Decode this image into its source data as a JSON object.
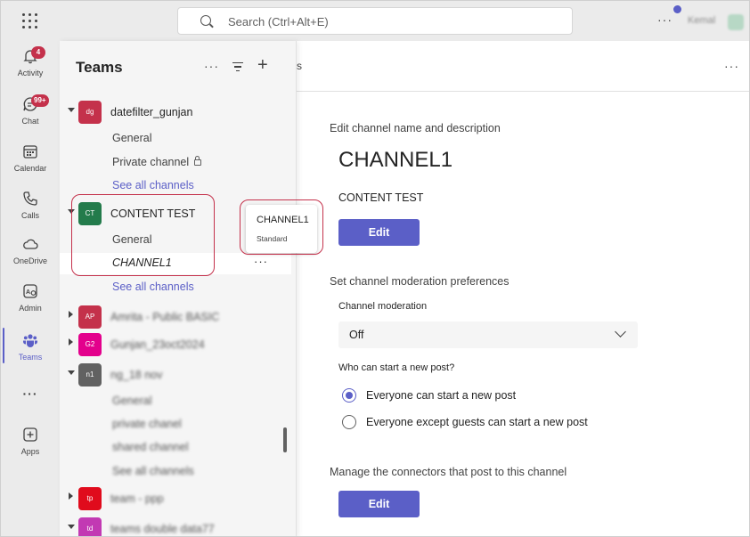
{
  "topbar": {
    "search_placeholder": "Search (Ctrl+Alt+E)",
    "more": "···",
    "user_name": "Kemal"
  },
  "rail": [
    {
      "label": "Activity",
      "icon": "bell-icon",
      "badge": "4"
    },
    {
      "label": "Chat",
      "icon": "chat-icon",
      "badge": "99+"
    },
    {
      "label": "Calendar",
      "icon": "calendar-icon"
    },
    {
      "label": "Calls",
      "icon": "phone-icon"
    },
    {
      "label": "OneDrive",
      "icon": "cloud-icon"
    },
    {
      "label": "Admin",
      "icon": "admin-icon"
    },
    {
      "label": "Teams",
      "icon": "teams-icon",
      "active": true
    },
    {
      "label": "···",
      "icon": "more-icon"
    },
    {
      "label": "Apps",
      "icon": "apps-plus-icon"
    }
  ],
  "teams_panel": {
    "title": "Teams",
    "more": "···",
    "teams": [
      {
        "initials": "dg",
        "name": "datefilter_gunjan",
        "color": "#c4314b",
        "expanded": true,
        "channels": [
          "General",
          "Private channel"
        ],
        "see_all": "See all channels"
      },
      {
        "initials": "CT",
        "name": "CONTENT TEST",
        "color": "#237b4b",
        "expanded": true,
        "channels": [
          "General",
          "CHANNEL1"
        ],
        "see_all": "See all channels"
      },
      {
        "initials": "AP",
        "name": "Amrita - Public BASIC",
        "color": "#c4314b",
        "expanded": false
      },
      {
        "initials": "G2",
        "name": "Gunjan_23oct2024",
        "color": "#e3008c",
        "expanded": false
      },
      {
        "initials": "n1",
        "name": "ng_18 nov",
        "color": "#616161",
        "expanded": true,
        "channels": [
          "General",
          "private chanel",
          "shared channel"
        ],
        "see_all": "See all channels"
      },
      {
        "initials": "tp",
        "name": "team - ppp",
        "color": "#e00b1c",
        "expanded": false
      },
      {
        "initials": "td",
        "name": "teams double data77",
        "color": "#c239b3",
        "expanded": false
      }
    ]
  },
  "tooltip": {
    "title": "CHANNEL1",
    "subtitle": "Standard"
  },
  "main": {
    "header_fragment": "s",
    "more": "···",
    "edit_section_title": "Edit channel name and description",
    "channel_name": "CHANNEL1",
    "channel_description": "CONTENT TEST",
    "edit_button": "Edit",
    "moderation_section_title": "Set channel moderation preferences",
    "moderation_label": "Channel moderation",
    "moderation_value": "Off",
    "who_can_post_label": "Who can start a new post?",
    "radio_options": [
      {
        "label": "Everyone can start a new post",
        "selected": true
      },
      {
        "label": "Everyone except guests can start a new post",
        "selected": false
      }
    ],
    "connectors_section_title": "Manage the connectors that post to this channel",
    "connectors_edit_button": "Edit"
  },
  "colors": {
    "accent": "#5b5fc7",
    "highlight": "#c4314b"
  }
}
